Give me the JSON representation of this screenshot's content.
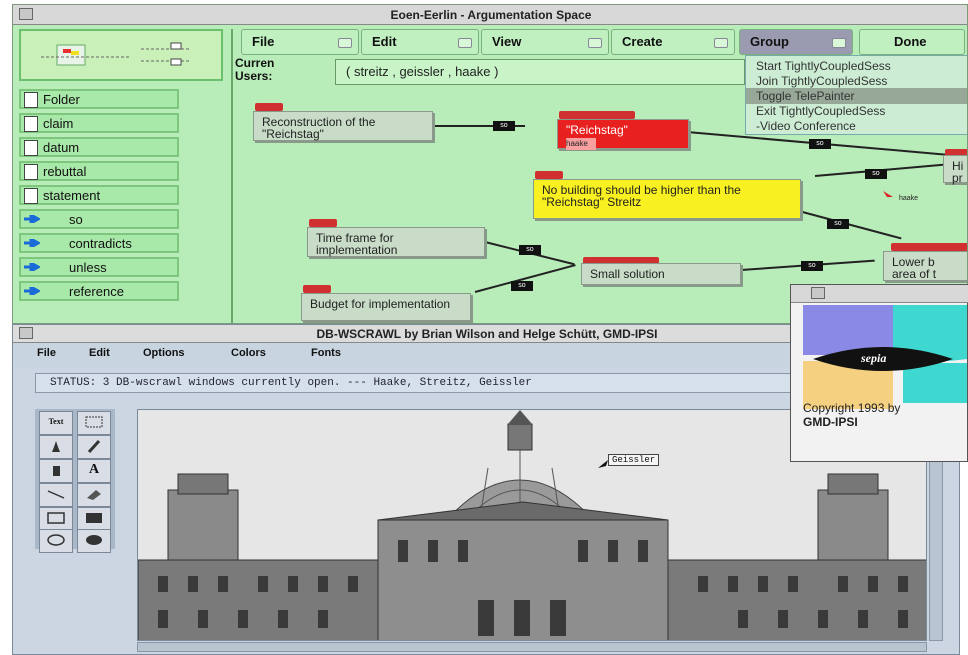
{
  "top_window": {
    "title": "Eoen-Eerlin - Argumentation Space"
  },
  "palette": {
    "items": [
      {
        "label": "Folder",
        "kind": "doc"
      },
      {
        "label": "claim",
        "kind": "doc"
      },
      {
        "label": "datum",
        "kind": "doc"
      },
      {
        "label": "rebuttal",
        "kind": "doc"
      },
      {
        "label": "statement",
        "kind": "doc"
      },
      {
        "label": "so",
        "kind": "arrow"
      },
      {
        "label": "contradicts",
        "kind": "arrow"
      },
      {
        "label": "unless",
        "kind": "arrow"
      },
      {
        "label": "reference",
        "kind": "arrow"
      }
    ]
  },
  "menubar": {
    "file": "File",
    "edit": "Edit",
    "view": "View",
    "create": "Create",
    "group": "Group",
    "done": "Done"
  },
  "users": {
    "label": "Curren Users:",
    "value": "( streitz , geissler , haake )"
  },
  "group_menu": {
    "items": [
      "Start TightlyCoupledSess",
      "Join TightlyCoupledSess",
      "Toggle TelePainter",
      "Exit TightlyCoupledSess",
      "-Video Conference"
    ]
  },
  "graph": {
    "nodes": [
      {
        "id": "reconstruction",
        "text": "Reconstruction of the \"Reichstag\""
      },
      {
        "id": "highlighted",
        "text": "\"Reichstag\"",
        "sub": "haake"
      },
      {
        "id": "no-building",
        "text": "No building should be higher than the \"Reichstag\" Streitz"
      },
      {
        "id": "timeframe",
        "text": "Time frame for implementation"
      },
      {
        "id": "small-solution",
        "text": "Small solution"
      },
      {
        "id": "budget",
        "text": "Budget for implementation"
      },
      {
        "id": "right-top",
        "text": "Hi pr"
      },
      {
        "id": "lower",
        "text": "Lower b area of t"
      }
    ],
    "edge_label": "so",
    "cursor_user": "haake"
  },
  "bottom_window": {
    "title": "DB-WSCRAWL by Brian Wilson and Helge Schütt, GMD-IPSI",
    "menus": [
      "File",
      "Edit",
      "Options",
      "Colors",
      "Fonts"
    ],
    "status": "STATUS:  3 DB-wscrawl windows currently open.  ---  Haake, Streitz, Geissler",
    "cursor_user": "Geissler",
    "tools": [
      "Text",
      "rect-select",
      "stamp",
      "pencil",
      "spray",
      "A",
      "line",
      "eraser",
      "rectangle",
      "filled-rectangle",
      "oval",
      "filled-oval"
    ]
  },
  "splash": {
    "logo_text": "sepia",
    "copyright": "Copyright 1993 by",
    "company": "GMD-IPSI"
  },
  "colors": {
    "top_bg": "#b8ecb8",
    "red_node": "#e82020",
    "yellow_node": "#f8f020",
    "bottom_bg": "#cbd6e2"
  }
}
